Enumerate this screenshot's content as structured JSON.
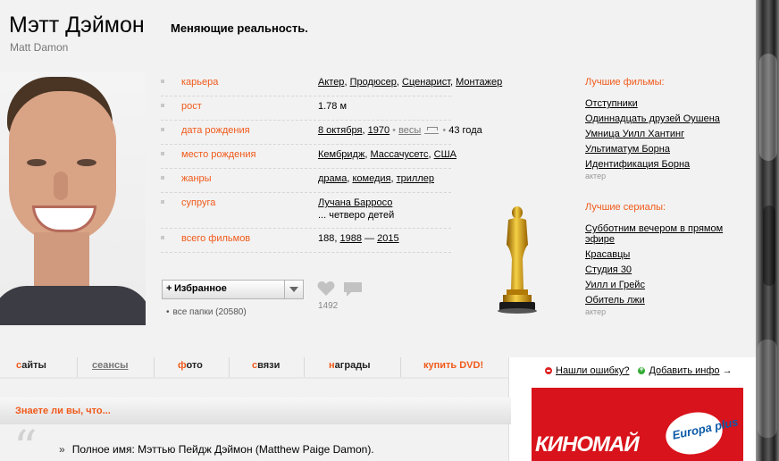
{
  "person": {
    "name_ru": "Мэтт Дэймон",
    "name_en": "Matt Damon",
    "motto": "Меняющие реальность."
  },
  "facts": {
    "career": {
      "label": "карьера",
      "items": [
        "Актер",
        "Продюсер",
        "Сценарист",
        "Монтажер"
      ]
    },
    "height": {
      "label": "рост",
      "value": "1.78 м"
    },
    "birth_date": {
      "label": "дата рождения",
      "day": "8 октября",
      "year": "1970",
      "libra": "весы",
      "age": "43 года"
    },
    "birth_place": {
      "label": "место рождения",
      "items": [
        "Кембридж",
        "Массачусетс",
        "США"
      ]
    },
    "genres": {
      "label": "жанры",
      "items": [
        "драма",
        "комедия",
        "триллер"
      ]
    },
    "spouse": {
      "label": "супруга",
      "name": "Лучана Барросо",
      "children": "... четверо детей"
    },
    "total_films": {
      "label": "всего фильмов",
      "count": "188",
      "from": "1988",
      "dash": "—",
      "to": "2015"
    }
  },
  "favorites": {
    "plus": "+",
    "label": "Избранное",
    "folders": "все папки (20580)",
    "likes": "1492"
  },
  "best_films": {
    "title": "Лучшие фильмы:",
    "items": [
      "Отступники",
      "Одиннадцать друзей Оушена",
      "Умница Уилл Хантинг",
      "Ультиматум Борна",
      "Идентификация Борна"
    ],
    "role": "актер"
  },
  "best_series": {
    "title": "Лучшие сериалы:",
    "items": [
      "Субботним вечером в прямом",
      "эфире",
      "Красавцы",
      "Студия 30",
      "Уилл и Грейс",
      "Обитель лжи"
    ],
    "role": "актер"
  },
  "tabs": [
    {
      "first": "с",
      "rest": "айты"
    },
    {
      "first": "",
      "rest": "сеансы"
    },
    {
      "first": "ф",
      "rest": "ото"
    },
    {
      "first": "с",
      "rest": "вязи"
    },
    {
      "first": "н",
      "rest": "аграды"
    },
    {
      "first": "",
      "rest": "купить DVD!"
    }
  ],
  "right_box": {
    "error_link": "Нашли ошибку?",
    "add_link": "Добавить инфо",
    "arrow": "→",
    "banner_text": "КИНОМАЙ",
    "banner_logo": "Europa plus"
  },
  "did_you_know": {
    "title": "Знаете ли вы, что...",
    "quote_mark": "“",
    "raquo": "»",
    "fact": "Полное имя: Мэттью Пейдж Дэймон (Matthew Paige Damon)."
  },
  "colors": {
    "accent": "#f05a1a",
    "page_bg": "#f2f2f2",
    "banner_red": "#d8131b"
  }
}
